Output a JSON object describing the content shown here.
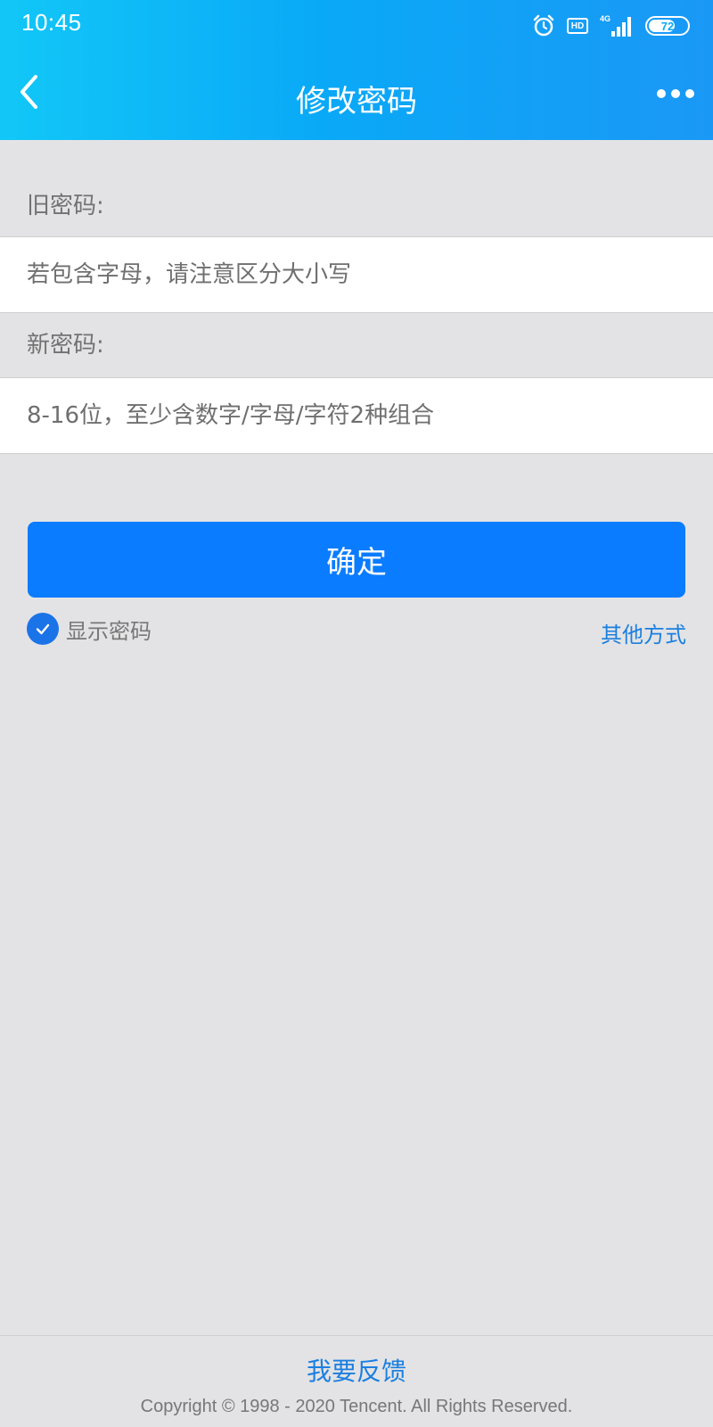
{
  "status_bar": {
    "time": "10:45",
    "hd_label": "HD",
    "network_label": "4G",
    "battery_level": "72",
    "icons": [
      "alarm-icon",
      "hd-icon",
      "signal-4g-icon",
      "battery-icon"
    ]
  },
  "nav": {
    "title": "修改密码",
    "back_icon": "chevron-left-icon",
    "more_icon": "more-dots-icon"
  },
  "form": {
    "old_password": {
      "label": "旧密码:",
      "placeholder": "若包含字母，请注意区分大小写",
      "value": ""
    },
    "new_password": {
      "label": "新密码:",
      "placeholder": "8-16位，至少含数字/字母/字符2种组合",
      "value": ""
    },
    "confirm_label": "确定",
    "show_password": {
      "label": "显示密码",
      "checked": true
    },
    "other_methods_label": "其他方式"
  },
  "footer": {
    "feedback_label": "我要反馈",
    "copyright": "Copyright © 1998 - 2020 Tencent. All Rights Reserved."
  },
  "colors": {
    "header_gradient_start": "#12c7f7",
    "header_gradient_end": "#1a98f6",
    "primary_button": "#0a7cff",
    "link": "#1b7fe0",
    "background": "#e3e3e5"
  }
}
